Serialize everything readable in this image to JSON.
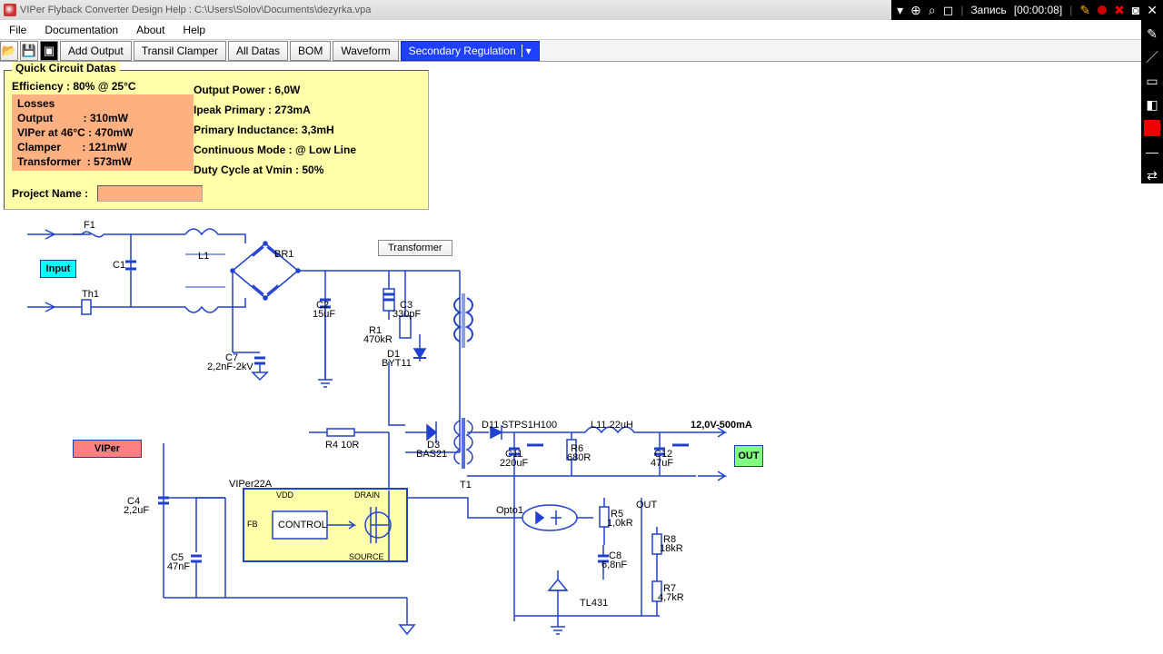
{
  "title": "VIPer Flyback Converter Design Help :   C:\\Users\\Solov\\Documents\\dezyrka.vpa",
  "recorder": {
    "label": "Запись",
    "time": "[00:00:08]"
  },
  "menu": {
    "file": "File",
    "documentation": "Documentation",
    "about": "About",
    "help": "Help"
  },
  "toolbar": {
    "add_output": "Add Output",
    "transil": "Transil Clamper",
    "all_datas": "All Datas",
    "bom": "BOM",
    "waveform": "Waveform",
    "secondary_reg": "Secondary Regulation"
  },
  "panel": {
    "legend": "Quick Circuit Datas",
    "efficiency": "Efficiency : 80% @ 25°C",
    "losses_title": "Losses",
    "loss_output": "Output          : 310mW",
    "loss_viper": "VIPer at 46°C : 470mW",
    "loss_clamper": "Clamper       : 121mW",
    "loss_trans": "Transformer  : 573mW",
    "out_power": "Output Power : 6,0W",
    "ipeak": "Ipeak Primary : 273mA",
    "prim_ind": "Primary Inductance: 3,3mH",
    "cont_mode": "Continuous Mode : @ Low Line",
    "duty": "Duty Cycle at Vmin : 50%",
    "project": "Project Name :"
  },
  "sch": {
    "transformer_btn": "Transformer",
    "input": "Input",
    "viper": "VIPer",
    "out": "OUT",
    "out_text": "OUT",
    "control": "CONTROL",
    "output_spec": "12,0V-500mA",
    "f1": "F1",
    "th1": "Th1",
    "c1": "C1",
    "l1": "L1",
    "br1": "BR1",
    "c2": "C2",
    "c2v": "15uF",
    "c3": "C3",
    "c3v": "330pF",
    "r1": "R1",
    "r1v": "470kR",
    "d1": "D1",
    "d1v": "BYT11",
    "c7": "C7",
    "c7v": "2,2nF-2kV",
    "r4": "R4 10R",
    "d3": "D3",
    "d3v": "BAS21",
    "t1": "T1",
    "d11": "D11",
    "d11v": "STPS1H100",
    "l11": "L11 22uH",
    "c11": "C11",
    "c11v": "220uF",
    "r6": "R6",
    "r6v": "680R",
    "c12": "C12",
    "c12v": "47uF",
    "c4": "C4",
    "c4v": "2,2uF",
    "c5": "C5",
    "c5v": "47nF",
    "viper22a": "VIPer22A",
    "vdd": "VDD",
    "drain": "DRAIN",
    "fb": "FB",
    "source": "SOURCE",
    "opto": "Opto1",
    "r5": "R5",
    "r5v": "1,0kR",
    "r8": "R8",
    "r8v": "18kR",
    "r7": "R7",
    "r7v": "4,7kR",
    "c8": "C8",
    "c8v": "6,8nF",
    "tl431": "TL431"
  }
}
